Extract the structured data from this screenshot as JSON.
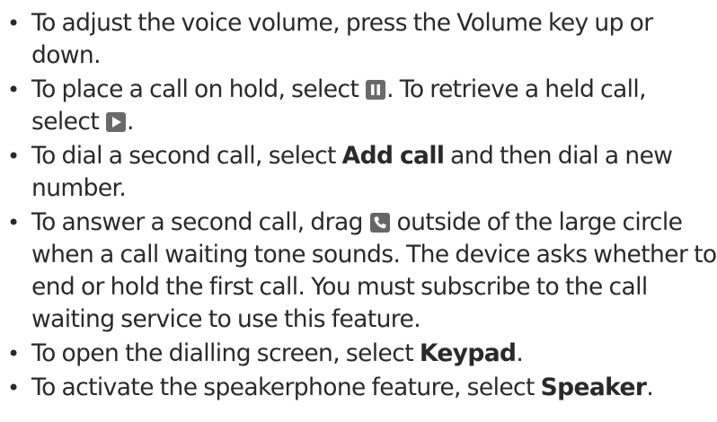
{
  "items": [
    {
      "text1": "To adjust the voice volume, press the Volume key up or down."
    },
    {
      "text1": "To place a call on hold, select ",
      "icon1": "pause-icon",
      "text2": ". To retrieve a held call, select ",
      "icon2": "play-icon",
      "text3": "."
    },
    {
      "text1": "To dial a second call, select ",
      "bold1": "Add call",
      "text2": " and then dial a new number."
    },
    {
      "text1": "To answer a second call, drag ",
      "icon1": "phone-icon",
      "text2": " outside of the large circle when a call waiting tone sounds. The device asks whether to end or hold the first call. You must subscribe to the call waiting service to use this feature."
    },
    {
      "text1": "To open the dialling screen, select ",
      "bold1": "Keypad",
      "text2": "."
    },
    {
      "text1": "To activate the speakerphone feature, select ",
      "bold1": "Speaker",
      "text2": "."
    }
  ],
  "bullet_char": "•",
  "colors": {
    "text": "#2a2a2a",
    "icon_background": "#666666",
    "icon_foreground": "#ffffff"
  }
}
